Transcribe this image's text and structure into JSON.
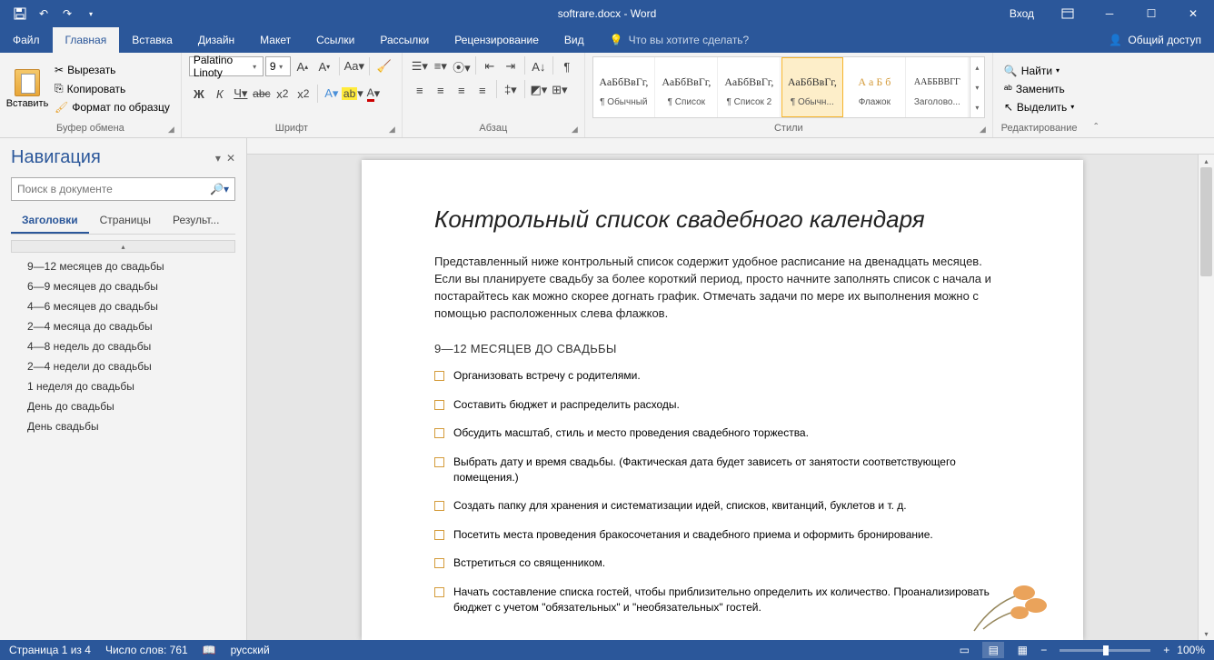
{
  "title": "softrare.docx - Word",
  "login": "Вход",
  "tabs": {
    "file": "Файл",
    "home": "Главная",
    "insert": "Вставка",
    "design": "Дизайн",
    "layout": "Макет",
    "references": "Ссылки",
    "mailings": "Рассылки",
    "review": "Рецензирование",
    "view": "Вид"
  },
  "tellme": "Что вы хотите сделать?",
  "share": "Общий доступ",
  "clipboard": {
    "paste": "Вставить",
    "cut": "Вырезать",
    "copy": "Копировать",
    "format": "Формат по образцу",
    "label": "Буфер обмена"
  },
  "font": {
    "name": "Palatino Linoty",
    "size": "9",
    "label": "Шрифт"
  },
  "paragraph": {
    "label": "Абзац"
  },
  "styles": {
    "label": "Стили",
    "items": [
      {
        "preview": "АаБбВвГг,",
        "name": "¶ Обычный"
      },
      {
        "preview": "АаБбВвГг,",
        "name": "¶ Список"
      },
      {
        "preview": "АаБбВвГг,",
        "name": "¶ Список 2"
      },
      {
        "preview": "АаБбВвГг,",
        "name": "¶ Обычн..."
      },
      {
        "preview": "А а Б б",
        "name": "Флажок",
        "color": "#d49b3a"
      },
      {
        "preview": "ААББВВГГ",
        "name": "Заголово..."
      }
    ]
  },
  "editing": {
    "find": "Найти",
    "replace": "Заменить",
    "select": "Выделить",
    "label": "Редактирование"
  },
  "nav": {
    "title": "Навигация",
    "search_placeholder": "Поиск в документе",
    "tabs": {
      "headings": "Заголовки",
      "pages": "Страницы",
      "results": "Результ..."
    },
    "items": [
      "9—12 месяцев до свадьбы",
      "6—9 месяцев до свадьбы",
      "4—6 месяцев до свадьбы",
      "2—4 месяца до свадьбы",
      "4—8 недель до свадьбы",
      "2—4 недели до свадьбы",
      "1 неделя до свадьбы",
      "День до свадьбы",
      "День свадьбы"
    ]
  },
  "doc": {
    "h1": "Контрольный список свадебного календаря",
    "intro": "Представленный ниже контрольный список содержит удобное расписание на двенадцать месяцев. Если вы планируете свадьбу за более короткий период, просто начните заполнять список с начала и постарайтесь как можно скорее догнать график. Отмечать задачи по мере их выполнения можно с помощью расположенных слева флажков.",
    "h2": "9—12 МЕСЯЦЕВ ДО СВАДЬБЫ",
    "checks": [
      "Организовать встречу с родителями.",
      "Составить бюджет и распределить расходы.",
      "Обсудить масштаб, стиль и место проведения свадебного торжества.",
      "Выбрать дату и время свадьбы. (Фактическая дата будет зависеть от занятости соответствующего помещения.)",
      "Создать папку для хранения и систематизации идей, списков, квитанций, буклетов и т. д.",
      "Посетить места проведения бракосочетания и свадебного приема и оформить бронирование.",
      "Встретиться со священником.",
      "Начать составление списка гостей, чтобы приблизительно определить их количество. Проанализировать бюджет с учетом \"обязательных\" и \"необязательных\" гостей."
    ]
  },
  "status": {
    "page": "Страница 1 из 4",
    "words": "Число слов: 761",
    "lang": "русский",
    "zoom": "100%"
  }
}
